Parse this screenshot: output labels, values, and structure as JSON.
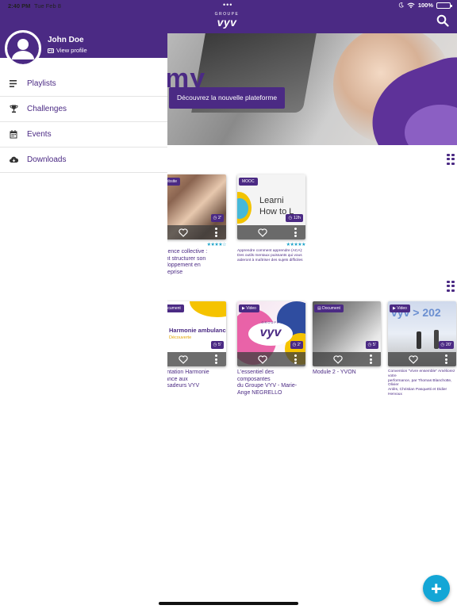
{
  "status_bar": {
    "time": "2:40 PM",
    "date": "Tue Feb 8",
    "battery": "100%",
    "battery_level": 1.0
  },
  "header": {
    "logo_small": "GROUPE",
    "logo_big": "vyv"
  },
  "hero": {
    "partial_text": "my",
    "cta_label": "Découvrez la nouvelle plateforme"
  },
  "drawer": {
    "user_name": "John Doe",
    "view_profile": "View profile",
    "menu": [
      {
        "label": "Playlists",
        "icon": "list-icon"
      },
      {
        "label": "Challenges",
        "icon": "trophy-icon"
      },
      {
        "label": "Events",
        "icon": "calendar-icon"
      },
      {
        "label": "Downloads",
        "icon": "cloud-download-icon"
      }
    ]
  },
  "section1": {
    "cards": [
      {
        "badge": "Website",
        "duration": "2'",
        "stars": "★★★★☆",
        "rating": 4,
        "title": "elligence collective :\nment structurer son\néveloppement en entreprise"
      },
      {
        "badge": "MOOC",
        "duration": "12h",
        "stars": "★★★★★",
        "rating": 5,
        "thumb_text": "Learni\nHow to L",
        "title": "Apprendre comment apprendre (ACA):\nDes outils mentaux puissants qui vous\naideront à maîtriser des sujets difficiles"
      }
    ]
  },
  "section2": {
    "cards": [
      {
        "badge": "Document",
        "duration": "5'",
        "thumb_text": "Harmonie ambulance",
        "thumb_sub": "Découverte",
        "title": "ésentation Harmonie\nbulance aux\nbassadeurs VYV"
      },
      {
        "badge": "Video",
        "duration": "2'",
        "thumb_text": "vyv",
        "thumb_sub": "GROUPE",
        "title": "L'essentiel des composantes\ndu Groupe VYV - Marie-\nAnge NEGRELLO"
      },
      {
        "badge": "Document",
        "duration": "5'",
        "title": "Module 2 - YVON"
      },
      {
        "badge": "Video",
        "duration": "20'",
        "thumb_text": "vyv > 202",
        "title": "Convention \"Vivre ensemble\" Améliorez votre\nperformance, par Thomas Blanchotte, Olivier\nAnlès, Christian Pasquetti et Didier Hervoux"
      }
    ]
  },
  "colors": {
    "primary": "#4b2a84",
    "accent": "#14a6d6",
    "star": "#19a1c8"
  }
}
